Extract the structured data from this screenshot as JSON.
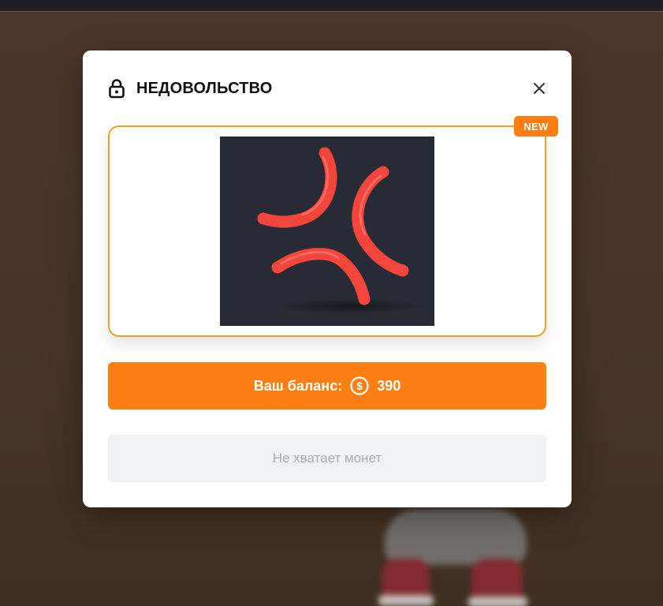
{
  "modal": {
    "title": "НЕДОВОЛЬСТВО",
    "title_icon": "lock-icon",
    "close_icon": "close-icon",
    "badge": "NEW",
    "item_image": "anger-symbol-sticker",
    "balance": {
      "label": "Ваш баланс:",
      "coin_icon": "dollar-coin-icon",
      "amount": "390"
    },
    "purchase_button": {
      "label": "Не хватает монет",
      "disabled": true
    }
  },
  "colors": {
    "accent": "#fc7f14",
    "card_border": "#f0a21c",
    "image_bg": "#282b35",
    "symbol": "#f2453c",
    "disabled_bg": "#f1f2f4",
    "disabled_text": "#a8adb6"
  }
}
